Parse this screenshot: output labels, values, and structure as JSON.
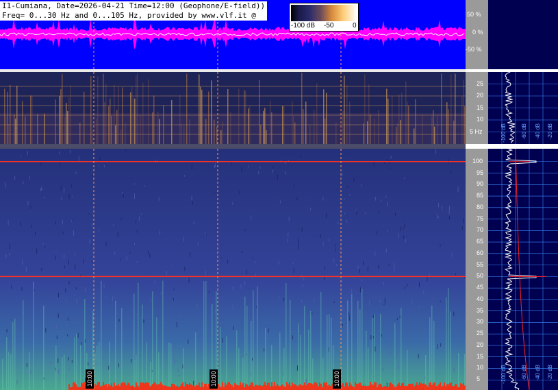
{
  "header": {
    "line1": "I1-Cumiana, Date=2026-04-21 Time=12:00 (Geophone/E-field))",
    "line2": "Freq= 0...30 Hz and 0...105 Hz, provided by www.vlf.it @"
  },
  "colorbar": {
    "ticks": [
      "-100 dB",
      "-50",
      "0"
    ]
  },
  "waveform_axis": [
    "50 %",
    "0 %",
    "-50 %"
  ],
  "upper_freq_axis": {
    "labels": [
      "25",
      "20",
      "15",
      "10",
      "5 Hz"
    ],
    "values": [
      25,
      20,
      15,
      10,
      5
    ],
    "max": 30
  },
  "lower_freq_axis": {
    "labels": [
      "100",
      "95",
      "90",
      "85",
      "80",
      "75",
      "70",
      "65",
      "60",
      "55",
      "50",
      "45",
      "40",
      "35",
      "30",
      "25",
      "20",
      "15",
      "10",
      "5"
    ],
    "values": [
      100,
      95,
      90,
      85,
      80,
      75,
      70,
      65,
      60,
      55,
      50,
      45,
      40,
      35,
      30,
      25,
      20,
      15,
      10,
      5
    ],
    "max": 105
  },
  "time_markers": [
    "10:00",
    "10:00",
    "10:00"
  ],
  "db_scale_upper": [
    "-100 dB",
    "-60 dB",
    "-40 dB",
    "-20 dB"
  ],
  "db_scale_lower": [
    "-100 dB",
    "-60 dB",
    "-40 dB",
    "-20 dB"
  ],
  "colors": {
    "waveform_bg": "#0000ff",
    "waveform_trace": "#ff00ff",
    "hum_line": "#ff2020",
    "right_panel_bg": "#000050",
    "grid": "#3c8cff"
  }
}
